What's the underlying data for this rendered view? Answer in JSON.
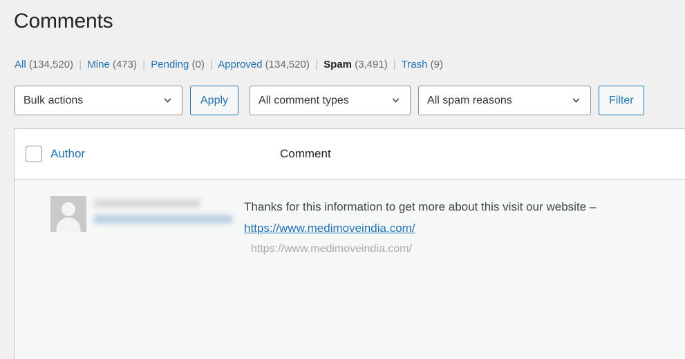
{
  "page": {
    "title": "Comments",
    "accent_color": "#2271b1",
    "background_color": "#f0f0f1",
    "table_background_color": "#f6f7f7"
  },
  "status_filters": {
    "separator": "|",
    "items": [
      {
        "label": "All",
        "count": "(134,520)",
        "current": false
      },
      {
        "label": "Mine",
        "count": "(473)",
        "current": false
      },
      {
        "label": "Pending",
        "count": "(0)",
        "current": false
      },
      {
        "label": "Approved",
        "count": "(134,520)",
        "current": false
      },
      {
        "label": "Spam",
        "count": "(3,491)",
        "current": true
      },
      {
        "label": "Trash",
        "count": "(9)",
        "current": false
      }
    ]
  },
  "toolbar": {
    "bulk_actions": {
      "selected": "Bulk actions",
      "icon": "chevron-down-icon"
    },
    "apply_label": "Apply",
    "comment_types": {
      "selected": "All comment types",
      "icon": "chevron-down-icon"
    },
    "spam_reasons": {
      "selected": "All spam reasons",
      "icon": "chevron-down-icon"
    },
    "filter_label": "Filter"
  },
  "table": {
    "columns": {
      "select_all": "select-all-checkbox",
      "author": "Author",
      "comment": "Comment"
    },
    "rows": [
      {
        "avatar": "mystery-person-avatar",
        "author_name_redacted": true,
        "author_email_redacted": true,
        "comment_text_before": "Thanks for this information to get more about this visit our website – ",
        "comment_link": "https://www.medimoveindia.com/",
        "comment_source_url": "https://www.medimoveindia.com/"
      }
    ]
  }
}
